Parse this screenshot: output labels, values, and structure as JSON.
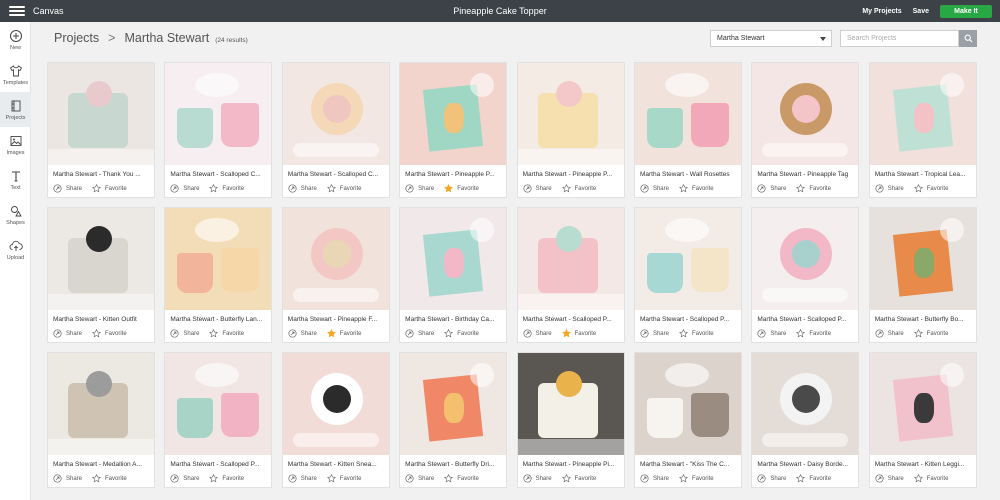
{
  "topbar": {
    "app_name": "Canvas",
    "doc_title": "Pineapple Cake Topper",
    "my_projects": "My Projects",
    "save": "Save",
    "make_it": "Make It"
  },
  "sidebar": {
    "items": [
      {
        "label": "New",
        "icon": "plus-circle-icon"
      },
      {
        "label": "Templates",
        "icon": "shirt-icon"
      },
      {
        "label": "Projects",
        "icon": "projects-icon"
      },
      {
        "label": "Images",
        "icon": "image-icon"
      },
      {
        "label": "Text",
        "icon": "text-icon"
      },
      {
        "label": "Shapes",
        "icon": "shapes-icon"
      },
      {
        "label": "Upload",
        "icon": "upload-icon"
      }
    ]
  },
  "header": {
    "crumb_root": "Projects",
    "crumb_sep": ">",
    "crumb_current": "Martha Stewart",
    "result_count": "(24 results)",
    "filter_value": "Martha Stewart",
    "search_placeholder": "Search Projects"
  },
  "actions": {
    "share": "Share",
    "favorite": "Favorite"
  },
  "colors": {
    "topbar": "#3c4248",
    "accent_green": "#28a745",
    "favorite_active": "#f5a623"
  },
  "projects": [
    {
      "title": "Martha Stewart - Thank You ...",
      "favorited": false,
      "bg": "#ece6e2",
      "accent": "#c8d8d0",
      "accent2": "#e8c9cc"
    },
    {
      "title": "Martha Stewart - Scalloped C...",
      "favorited": false,
      "bg": "#f6eef0",
      "accent": "#b9dcd2",
      "accent2": "#f3b9c8"
    },
    {
      "title": "Martha Stewart - Scalloped C...",
      "favorited": false,
      "bg": "#f2e7e2",
      "accent": "#f4d8b8",
      "accent2": "#efc7c0"
    },
    {
      "title": "Martha Stewart - Pineapple P...",
      "favorited": true,
      "bg": "#f3d4cc",
      "accent": "#9fd6c4",
      "accent2": "#f1c27a"
    },
    {
      "title": "Martha Stewart - Pineapple P...",
      "favorited": false,
      "bg": "#f4ece4",
      "accent": "#f6e0b0",
      "accent2": "#f4c8c8"
    },
    {
      "title": "Martha Stewart - Wall Rosettes",
      "favorited": false,
      "bg": "#f1e2dc",
      "accent": "#a8d8c8",
      "accent2": "#f2a8b8"
    },
    {
      "title": "Martha Stewart - Pineapple Tag",
      "favorited": false,
      "bg": "#f4e6e4",
      "accent": "#c99a68",
      "accent2": "#f3c4c8"
    },
    {
      "title": "Martha Stewart - Tropical Lea...",
      "favorited": false,
      "bg": "#f1e0dc",
      "accent": "#bfe0d4",
      "accent2": "#f2c2c6"
    },
    {
      "title": "Martha Stewart - Kitten Outfit",
      "favorited": false,
      "bg": "#ece8e4",
      "accent": "#d9d6d0",
      "accent2": "#2b2b2b"
    },
    {
      "title": "Martha Stewart - Butterfly Lan...",
      "favorited": false,
      "bg": "#f2ddb8",
      "accent": "#f2b49a",
      "accent2": "#f6d8a8"
    },
    {
      "title": "Martha Stewart - Pineapple F...",
      "favorited": true,
      "bg": "#f1e2dc",
      "accent": "#f3c8c4",
      "accent2": "#e8d6b4"
    },
    {
      "title": "Martha Stewart - Birthday Ca...",
      "favorited": false,
      "bg": "#f1e8ea",
      "accent": "#a8d8d0",
      "accent2": "#f2b8c8"
    },
    {
      "title": "Martha Stewart - Scalloped P...",
      "favorited": true,
      "bg": "#f4e8e6",
      "accent": "#f3c2c8",
      "accent2": "#b8dcd0"
    },
    {
      "title": "Martha Stewart - Scalloped P...",
      "favorited": false,
      "bg": "#f3ece6",
      "accent": "#a8d8d4",
      "accent2": "#f4e4c8"
    },
    {
      "title": "Martha Stewart - Scalloped P...",
      "favorited": false,
      "bg": "#f4eeee",
      "accent": "#f2b8c8",
      "accent2": "#a8d0cc"
    },
    {
      "title": "Martha Stewart - Butterfly Bo...",
      "favorited": false,
      "bg": "#e6e1dc",
      "accent": "#e88a4a",
      "accent2": "#8aa868"
    },
    {
      "title": "Martha Stewart - Medallion A...",
      "favorited": false,
      "bg": "#ece8e2",
      "accent": "#cfc4b4",
      "accent2": "#9c9c9c"
    },
    {
      "title": "Martha Stewart - Scalloped P...",
      "favorited": false,
      "bg": "#f1e6e4",
      "accent": "#a8d4c8",
      "accent2": "#f2b4c4"
    },
    {
      "title": "Martha Stewart - Kitten Snea...",
      "favorited": false,
      "bg": "#f2dcd8",
      "accent": "#ffffff",
      "accent2": "#2b2b2b"
    },
    {
      "title": "Martha Stewart - Butterfly Dri...",
      "favorited": false,
      "bg": "#efe8e2",
      "accent": "#f08868",
      "accent2": "#f4c070"
    },
    {
      "title": "Martha Stewart - Pineapple Pi...",
      "favorited": false,
      "bg": "#5a5652",
      "accent": "#f3f0e8",
      "accent2": "#e9b24a"
    },
    {
      "title": "Martha Stewart - \"Kiss The C...",
      "favorited": false,
      "bg": "#dcd4cc",
      "accent": "#f7f4f0",
      "accent2": "#9a8c80"
    },
    {
      "title": "Martha Stewart - Daisy Borde...",
      "favorited": false,
      "bg": "#e4dcd6",
      "accent": "#f3f3f3",
      "accent2": "#4a4a4a"
    },
    {
      "title": "Martha Stewart - Kitten Leggi...",
      "favorited": false,
      "bg": "#ece4e2",
      "accent": "#f2c2cc",
      "accent2": "#3a3a3a"
    }
  ]
}
